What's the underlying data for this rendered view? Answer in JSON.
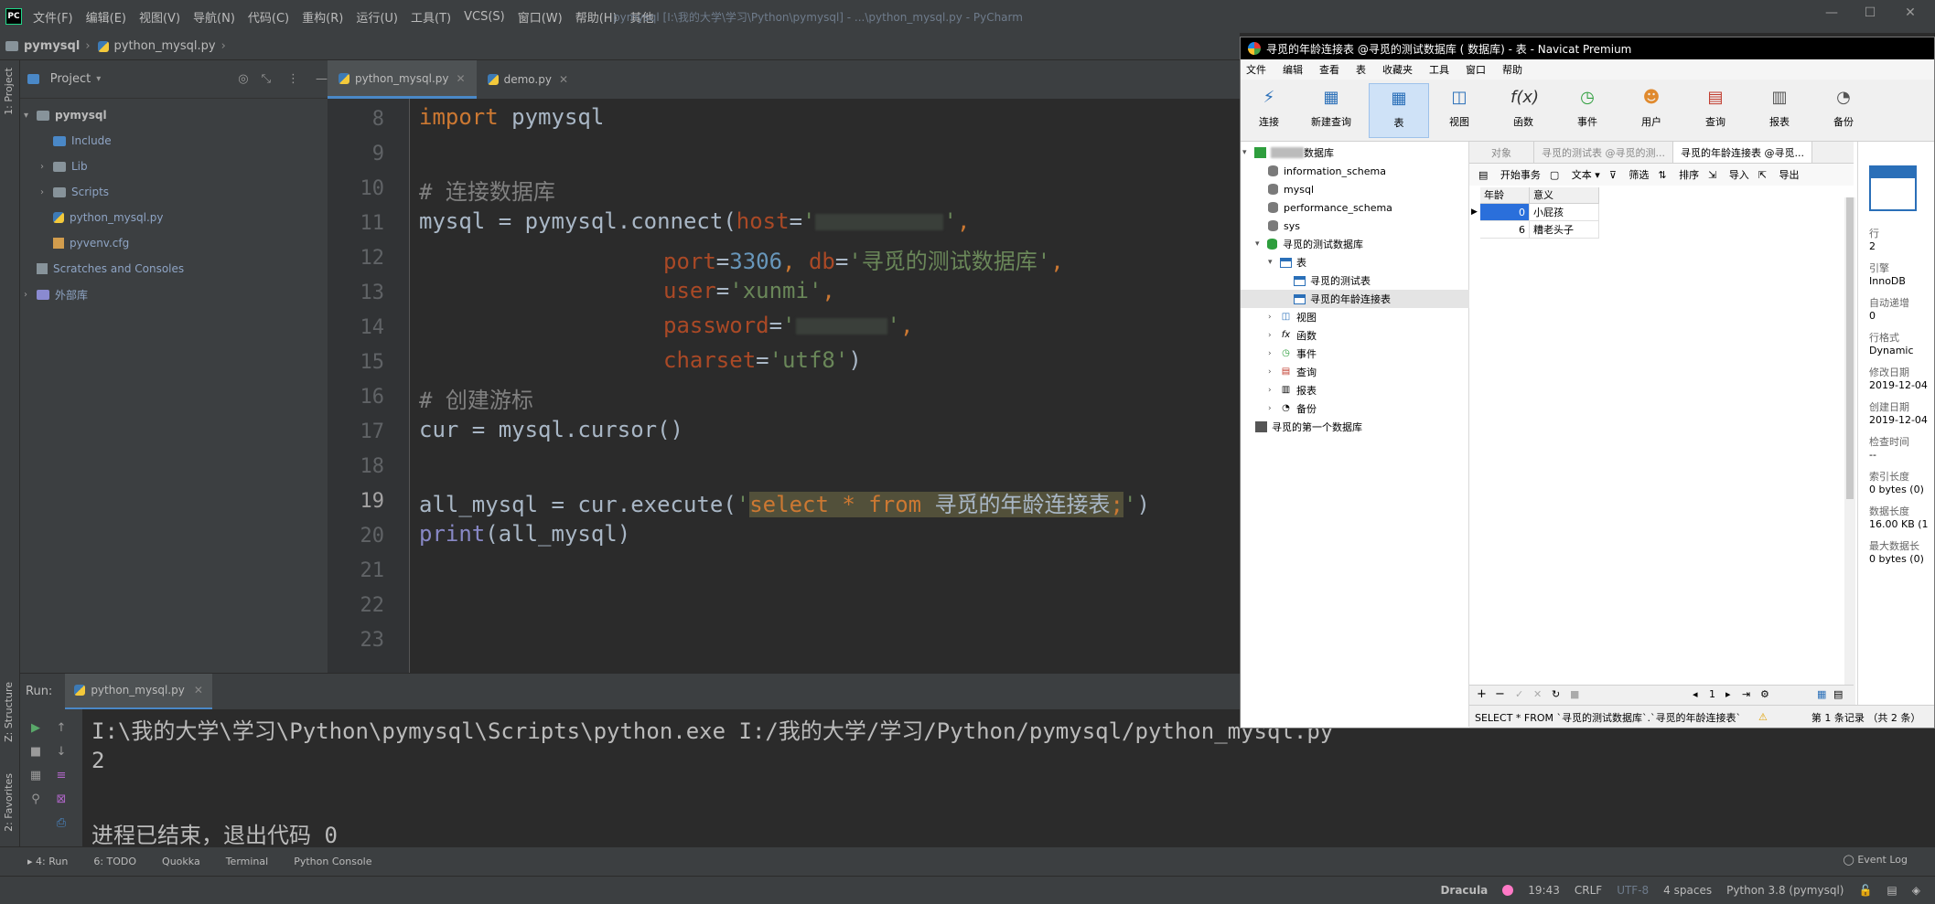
{
  "pycharm": {
    "logo_text": "PC",
    "menu": [
      "文件(F)",
      "编辑(E)",
      "视图(V)",
      "导航(N)",
      "代码(C)",
      "重构(R)",
      "运行(U)",
      "工具(T)",
      "VCS(S)",
      "窗口(W)",
      "帮助(H)",
      "其他"
    ],
    "window_title": "pymysql [I:\\我的大学\\学习\\Python\\pymysql] - ...\\python_mysql.py - PyCharm",
    "window_controls": {
      "minimize": "—",
      "maximize": "☐",
      "close": "✕"
    },
    "breadcrumb": [
      "pymysql",
      "python_mysql.py"
    ],
    "left_tabs": {
      "project": "1: Project",
      "structure": "Z: Structure",
      "favorites": "2: Favorites"
    },
    "project_panel": {
      "title": "Project",
      "tree": [
        {
          "label": "pymysql",
          "type": "folder",
          "depth": 0,
          "expanded": true
        },
        {
          "label": "Include",
          "type": "folder",
          "depth": 1
        },
        {
          "label": "Lib",
          "type": "folder",
          "depth": 1
        },
        {
          "label": "Scripts",
          "type": "folder",
          "depth": 1
        },
        {
          "label": "python_mysql.py",
          "type": "py",
          "depth": 1
        },
        {
          "label": "pyvenv.cfg",
          "type": "cfg",
          "depth": 1
        },
        {
          "label": "Scratches and Consoles",
          "type": "scratch",
          "depth": 0
        },
        {
          "label": "外部库",
          "type": "lib",
          "depth": 0
        }
      ]
    },
    "editor_tabs": [
      "python_mysql.py",
      "demo.py"
    ],
    "line_numbers": [
      "8",
      "9",
      "10",
      "11",
      "12",
      "13",
      "14",
      "15",
      "16",
      "17",
      "18",
      "19",
      "20",
      "21",
      "22",
      "23"
    ],
    "code": {
      "l8_kw": "import",
      "l8_mod": " pymysql",
      "l10": "# 连接数据库",
      "l11_a": "mysql = pymysql.connect(",
      "l11_p": "host",
      "l11_eq": "=",
      "l11_q": "'",
      "l11_q2": "'",
      "l11_c": ",",
      "l12_p": "port",
      "l12_eq": "=",
      "l12_n": "3306",
      "l12_c": ", ",
      "l12_p2": "db",
      "l12_eq2": "=",
      "l12_s": "'寻觅的测试数据库'",
      "l12_c2": ",",
      "l13_p": "user",
      "l13_eq": "=",
      "l13_s": "'xunmi'",
      "l13_c": ",",
      "l14_p": "password",
      "l14_eq": "=",
      "l14_q": "'",
      "l14_q2": "'",
      "l14_c": ",",
      "l15_p": "charset",
      "l15_eq": "=",
      "l15_s": "'utf8'",
      "l15_c": ")",
      "l16": "# 创建游标",
      "l17": "cur = mysql.cursor()",
      "l19_a": "all_mysql = cur.execute(",
      "l19_q": "'",
      "l19_s1": "select",
      "l19_s2": " * ",
      "l19_s3": "from",
      "l19_s4": " 寻觅的年龄连接表",
      "l19_s5": ";",
      "l19_q2": "'",
      "l19_c": ")",
      "l20_fn": "print",
      "l20_rest": "(all_mysql)"
    },
    "run_panel": {
      "label": "Run:",
      "tab": "python_mysql.py",
      "output": [
        "I:\\我的大学\\学习\\Python\\pymysql\\Scripts\\python.exe I:/我的大学/学习/Python/pymysql/python_mysql.py",
        "2",
        "",
        "进程已结束，退出代码 0"
      ]
    },
    "bottom_tools": [
      "4: Run",
      "6: TODO",
      "Quokka",
      "Terminal",
      "Python Console"
    ],
    "event_log": "Event Log",
    "status": {
      "theme": "Dracula",
      "position": "19:43",
      "line_sep": "CRLF",
      "encoding": "UTF-8",
      "indent": "4 spaces",
      "interpreter": "Python 3.8 (pymysql)"
    }
  },
  "navicat": {
    "title": "寻觅的年龄连接表 @寻觅的测试数据库 (        数据库) - 表 - Navicat Premium",
    "menu": [
      "文件",
      "编辑",
      "查看",
      "表",
      "收藏夹",
      "工具",
      "窗口",
      "帮助"
    ],
    "toolbar": [
      "连接",
      "新建查询",
      "表",
      "视图",
      "函数",
      "事件",
      "用户",
      "查询",
      "报表",
      "备份"
    ],
    "tree": [
      {
        "label": "数据库",
        "depth": 0,
        "icon": "conn"
      },
      {
        "label": "information_schema",
        "depth": 1,
        "icon": "db"
      },
      {
        "label": "mysql",
        "depth": 1,
        "icon": "db"
      },
      {
        "label": "performance_schema",
        "depth": 1,
        "icon": "db"
      },
      {
        "label": "sys",
        "depth": 1,
        "icon": "db"
      },
      {
        "label": "寻觅的测试数据库",
        "depth": 1,
        "icon": "db-green"
      },
      {
        "label": "表",
        "depth": 2,
        "icon": "table"
      },
      {
        "label": "寻觅的测试表",
        "depth": 3,
        "icon": "table"
      },
      {
        "label": "寻觅的年龄连接表",
        "depth": 3,
        "icon": "table"
      },
      {
        "label": "视图",
        "depth": 2,
        "icon": "view"
      },
      {
        "label": "函数",
        "depth": 2,
        "icon": "fx"
      },
      {
        "label": "事件",
        "depth": 2,
        "icon": "event"
      },
      {
        "label": "查询",
        "depth": 2,
        "icon": "query"
      },
      {
        "label": "报表",
        "depth": 2,
        "icon": "report"
      },
      {
        "label": "备份",
        "depth": 2,
        "icon": "backup"
      },
      {
        "label": "寻觅的第一个数据库",
        "depth": 0,
        "icon": "conn"
      }
    ],
    "tabs": [
      "对象",
      "寻觅的测试表 @寻觅的测...",
      "寻觅的年龄连接表 @寻觅..."
    ],
    "subtools": [
      "开始事务",
      "文本",
      "筛选",
      "排序",
      "导入",
      "导出"
    ],
    "grid": {
      "columns": [
        "年龄",
        "意义"
      ],
      "rows": [
        [
          "0",
          "小屁孩"
        ],
        [
          "6",
          "糟老头子"
        ]
      ]
    },
    "sql_status": "SELECT * FROM `寻觅的测试数据库`.`寻觅的年龄连接表`",
    "record_status": "第 1 条记录 （共 2 条）",
    "page": "1",
    "info": [
      {
        "label": "行",
        "value": "2"
      },
      {
        "label": "引擎",
        "value": "InnoDB"
      },
      {
        "label": "自动递增",
        "value": "0"
      },
      {
        "label": "行格式",
        "value": "Dynamic"
      },
      {
        "label": "修改日期",
        "value": "2019-12-04"
      },
      {
        "label": "创建日期",
        "value": "2019-12-04"
      },
      {
        "label": "检查时间",
        "value": "--"
      },
      {
        "label": "索引长度",
        "value": "0 bytes (0)"
      },
      {
        "label": "数据长度",
        "value": "16.00 KB (1"
      },
      {
        "label": "最大数据长",
        "value": "0 bytes (0)"
      }
    ]
  }
}
